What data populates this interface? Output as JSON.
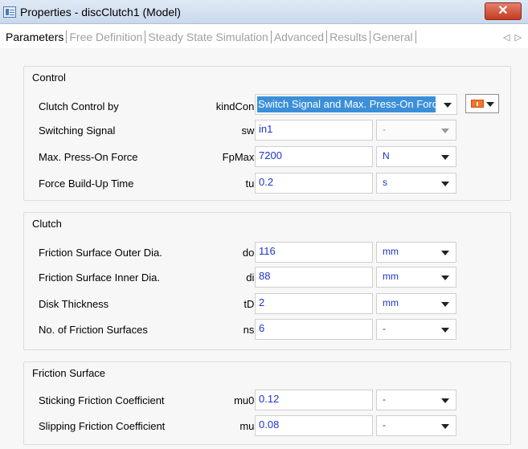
{
  "window": {
    "title": "Properties - discClutch1 (Model)",
    "close_label": "✕"
  },
  "tabs": [
    {
      "label": "Parameters",
      "active": true
    },
    {
      "label": "Free Definition",
      "active": false
    },
    {
      "label": "Steady State Simulation",
      "active": false
    },
    {
      "label": "Advanced",
      "active": false
    },
    {
      "label": "Results",
      "active": false
    },
    {
      "label": "General",
      "active": false
    }
  ],
  "tab_scroll": {
    "left": "◁",
    "right": "▷"
  },
  "control": {
    "title": "Control",
    "clutch_control": {
      "label": "Clutch Control by",
      "var": "kindCon:",
      "value": "Switch Signal and Max. Press-On Force"
    },
    "switching_signal": {
      "label": "Switching Signal",
      "var": "sw:",
      "value": "in1",
      "unit": "-"
    },
    "max_press_force": {
      "label": "Max. Press-On Force",
      "var": "FpMax:",
      "value": "7200",
      "unit": "N"
    },
    "build_up_time": {
      "label": "Force Build-Up Time",
      "var": "tu:",
      "value": "0.2",
      "unit": "s"
    }
  },
  "clutch": {
    "title": "Clutch",
    "outer_dia": {
      "label": "Friction Surface Outer Dia.",
      "var": "do:",
      "value": "116",
      "unit": "mm"
    },
    "inner_dia": {
      "label": "Friction Surface Inner Dia.",
      "var": "di:",
      "value": "88",
      "unit": "mm"
    },
    "disk_thickness": {
      "label": "Disk Thickness",
      "var": "tD:",
      "value": "2",
      "unit": "mm"
    },
    "num_surfaces": {
      "label": "No. of Friction Surfaces",
      "var": "ns:",
      "value": "6",
      "unit": "-"
    }
  },
  "friction": {
    "title": "Friction Surface",
    "sticking": {
      "label": "Sticking Friction Coefficient",
      "var": "mu0:",
      "value": "0.12",
      "unit": "-"
    },
    "slipping": {
      "label": "Slipping Friction Coefficient",
      "var": "mu:",
      "value": "0.08",
      "unit": "-"
    }
  },
  "colors": {
    "value_text": "#1d35c8",
    "selection": "#3b8fd9",
    "close_button": "#c43a21",
    "mode_icon": "#f0742b"
  }
}
